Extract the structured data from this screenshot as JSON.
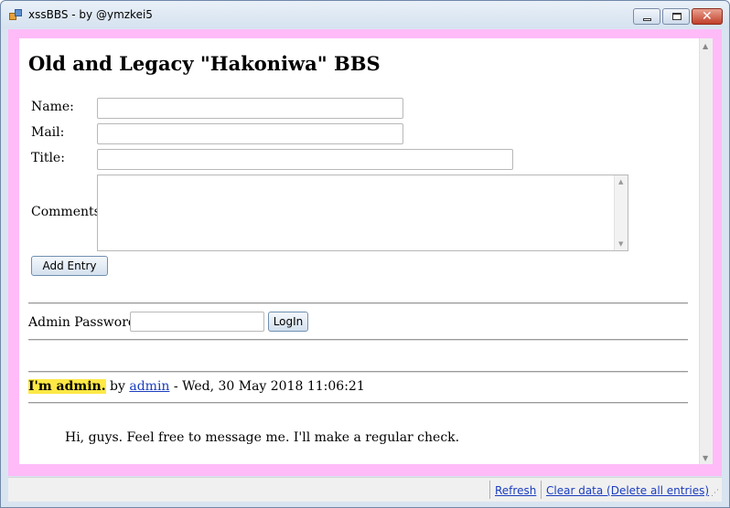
{
  "window": {
    "title": "xssBBS - by @ymzkei5"
  },
  "bbs": {
    "heading": "Old and Legacy \"Hakoniwa\" BBS",
    "form": {
      "name_label": "Name:",
      "mail_label": "Mail:",
      "title_label": "Title:",
      "comments_label": "Comments:",
      "name_value": "",
      "mail_value": "",
      "title_value": "",
      "comments_value": "",
      "add_entry_button": "Add Entry"
    },
    "admin": {
      "password_label": "Admin Password:",
      "password_value": "",
      "login_button": "LogIn"
    },
    "entries": [
      {
        "title": "I'm admin.",
        "by": "by",
        "author": "admin",
        "date": "- Wed, 30 May 2018 11:06:21",
        "message": "Hi, guys. Feel free to message me. I'll make a regular check."
      }
    ]
  },
  "statusbar": {
    "refresh": "Refresh",
    "clear": "Clear data (Delete all entries)"
  },
  "colors": {
    "frame_background": "#ffbbf8",
    "title_highlight": "#ffe945",
    "link": "#1a3dbe"
  }
}
